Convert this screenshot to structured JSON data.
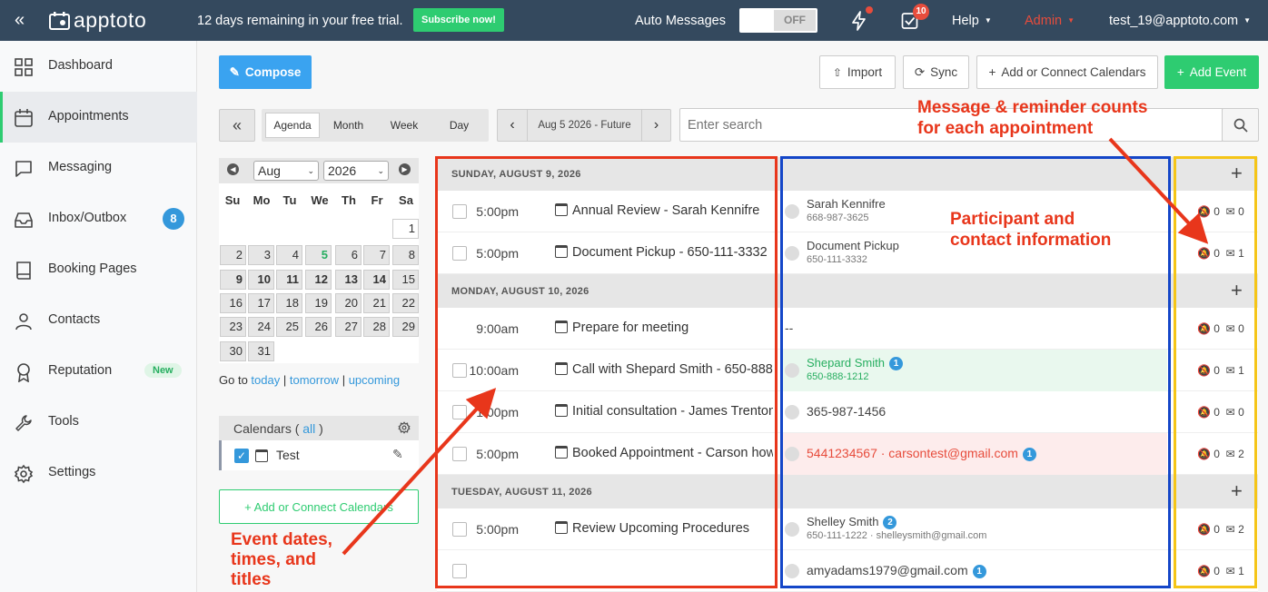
{
  "topbar": {
    "collapse_glyph": "«",
    "brand": "apptoto",
    "trial_text": "12 days remaining in your free trial.",
    "subscribe_label": "Subscribe now!",
    "auto_messages_label": "Auto Messages",
    "toggle_state": "OFF",
    "tasks_count": "10",
    "help_label": "Help",
    "admin_label": "Admin",
    "user_email": "test_19@apptoto.com"
  },
  "sidebar": {
    "items": [
      {
        "label": "Dashboard",
        "icon": "grid-icon"
      },
      {
        "label": "Appointments",
        "icon": "calendar-icon"
      },
      {
        "label": "Messaging",
        "icon": "chat-icon"
      },
      {
        "label": "Inbox/Outbox",
        "icon": "inbox-icon",
        "badge": "8"
      },
      {
        "label": "Booking Pages",
        "icon": "book-icon"
      },
      {
        "label": "Contacts",
        "icon": "user-icon"
      },
      {
        "label": "Reputation",
        "icon": "award-icon",
        "badge": "New"
      },
      {
        "label": "Tools",
        "icon": "wrench-icon"
      },
      {
        "label": "Settings",
        "icon": "gear-icon"
      }
    ]
  },
  "toolbar": {
    "compose_label": "Compose",
    "import_label": "Import",
    "sync_label": "Sync",
    "add_calendars_label": "Add or Connect Calendars",
    "add_event_label": "Add Event"
  },
  "views": {
    "collapse_label": "«",
    "tabs": [
      "Agenda",
      "Month",
      "Week",
      "Day"
    ],
    "active_tab": "Agenda",
    "date_range": "Aug 5 2026 - Future",
    "prev_glyph": "‹",
    "next_glyph": "›"
  },
  "search": {
    "placeholder": "Enter search"
  },
  "minical": {
    "month": "Aug",
    "year": "2026",
    "dow": [
      "Su",
      "Mo",
      "Tu",
      "We",
      "Th",
      "Fr",
      "Sa"
    ],
    "weeks": [
      [
        "",
        "",
        "",
        "",
        "",
        "",
        "1"
      ],
      [
        "2",
        "3",
        "4",
        "5",
        "6",
        "7",
        "8"
      ],
      [
        "9",
        "10",
        "11",
        "12",
        "13",
        "14",
        "15"
      ],
      [
        "16",
        "17",
        "18",
        "19",
        "20",
        "21",
        "22"
      ],
      [
        "23",
        "24",
        "25",
        "26",
        "27",
        "28",
        "29"
      ],
      [
        "30",
        "31",
        "",
        "",
        "",
        "",
        ""
      ]
    ],
    "today": "5",
    "bold_days": [
      "9",
      "10",
      "11",
      "12",
      "13",
      "14"
    ],
    "goto_label": "Go to",
    "goto_today": "today",
    "goto_tomorrow": "tomorrow",
    "goto_upcoming": "upcoming",
    "sep": "|"
  },
  "calendars": {
    "header_label": "Calendars (",
    "all_label": "all",
    "header_close": ")",
    "items": [
      {
        "label": "Test",
        "checked": true
      }
    ],
    "add_label": "+ Add or Connect Calendars"
  },
  "agenda": {
    "days": [
      {
        "header": "SUNDAY, AUGUST 9, 2026",
        "events": [
          {
            "time": "5:00pm",
            "title": "Annual Review - Sarah Kennifre",
            "pname": "Sarah Kennifre",
            "psub": "668-987-3625",
            "muted": "0",
            "msgs": "0"
          },
          {
            "time": "5:00pm",
            "title": "Document Pickup - 650-111-3332",
            "pname": "Document Pickup",
            "psub": "650-111-3332",
            "muted": "0",
            "msgs": "1"
          }
        ]
      },
      {
        "header": "MONDAY, AUGUST 10, 2026",
        "events": [
          {
            "time": "9:00am",
            "title": "Prepare for meeting",
            "pname": "--",
            "psub": "",
            "muted": "0",
            "msgs": "0"
          },
          {
            "time": "10:00am",
            "title": "Call with Shepard Smith - 650-888...",
            "pname": "Shepard Smith",
            "pbadge": "1",
            "psub": "650-888-1212",
            "muted": "0",
            "msgs": "1"
          },
          {
            "time": "1:00pm",
            "title": "Initial consultation - James Trenton",
            "pname": "365-987-1456",
            "psub": "",
            "muted": "0",
            "msgs": "0"
          },
          {
            "time": "5:00pm",
            "title": "Booked Appointment - Carson how...",
            "pname": "5441234567 · carsontest@gmail.com",
            "pbadge": "1",
            "psub": "",
            "muted": "0",
            "msgs": "2"
          }
        ]
      },
      {
        "header": "TUESDAY, AUGUST 11, 2026",
        "events": [
          {
            "time": "5:00pm",
            "title": "Review Upcoming Procedures",
            "pname": "Shelley Smith",
            "pbadge": "2",
            "psub": "650-111-1222 · shelleysmith@gmail.com",
            "muted": "0",
            "msgs": "2"
          },
          {
            "time": "",
            "title": "",
            "pname": "amyadams1979@gmail.com",
            "pbadge": "1",
            "psub": "",
            "muted": "0",
            "msgs": "1"
          }
        ]
      }
    ]
  },
  "annotations": {
    "events": [
      "Event dates,",
      "times, and",
      "titles"
    ],
    "participants": [
      "Participant and",
      "contact information"
    ],
    "counts": [
      "Message & reminder counts",
      "for each appointment"
    ]
  },
  "colors": {
    "accent_green": "#2ecc71",
    "accent_blue": "#3498db",
    "annotation_red": "#e8361b",
    "box_blue": "#1446c8",
    "box_gold": "#f5c518",
    "topbar": "#34495e"
  }
}
